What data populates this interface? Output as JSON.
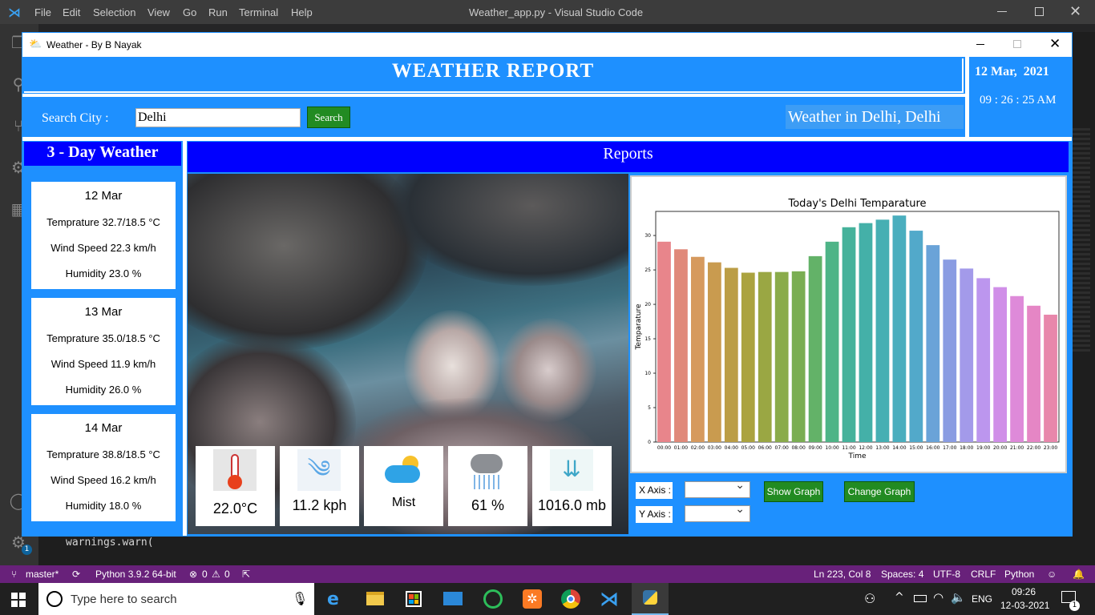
{
  "vscode": {
    "menu": [
      "File",
      "Edit",
      "Selection",
      "View",
      "Go",
      "Run",
      "Terminal",
      "Help"
    ],
    "window_title": "Weather_app.py - Visual Studio Code",
    "editor_line": "warnings.warn(",
    "status": {
      "branch": "master*",
      "python": "Python 3.9.2 64-bit",
      "errors": "0",
      "warnings": "0",
      "position": "Ln 223, Col 8",
      "spaces": "Spaces: 4",
      "encoding": "UTF-8",
      "eol": "CRLF",
      "language": "Python"
    },
    "accounts_badge": "1"
  },
  "taskbar": {
    "search_placeholder": "Type here to search",
    "lang": "ENG",
    "time": "09:26",
    "date": "12-03-2021",
    "notification_count": "1"
  },
  "app": {
    "window_title": "Weather - By B Nayak",
    "header_title": "WEATHER REPORT",
    "date": "12 Mar,  2021",
    "time": "09 : 26 : 25 AM",
    "search_label": "Search City :",
    "search_value": "Delhi",
    "search_button": "Search",
    "location_text": "Weather in Delhi, Delhi",
    "forecast_title": "3 - Day Weather",
    "reports_title": "Reports",
    "forecast": [
      {
        "day": "12 Mar",
        "temp": "Temprature 32.7/18.5 °C",
        "wind": "Wind Speed 22.3 km/h",
        "humidity": "Humidity 23.0 %"
      },
      {
        "day": "13 Mar",
        "temp": "Temprature 35.0/18.5 °C",
        "wind": "Wind Speed 11.9 km/h",
        "humidity": "Humidity 26.0 %"
      },
      {
        "day": "14 Mar",
        "temp": "Temprature 38.8/18.5 °C",
        "wind": "Wind Speed 16.2 km/h",
        "humidity": "Humidity 18.0 %"
      }
    ],
    "current": {
      "temperature": "22.0°C",
      "wind": "11.2 kph",
      "condition": "Mist",
      "humidity": "61 %",
      "pressure": "1016.0 mb"
    },
    "x_axis_label": "X Axis :",
    "y_axis_label": "Y Axis :",
    "show_graph": "Show Graph",
    "change_graph": "Change Graph"
  },
  "chart_data": {
    "type": "bar",
    "title": "Today's Delhi Temparature",
    "xlabel": "Time",
    "ylabel": "Temparature",
    "ylim": [
      0,
      33.5
    ],
    "yticks": [
      0,
      5,
      10,
      15,
      20,
      25,
      30
    ],
    "categories": [
      "00:00",
      "01:00",
      "02:00",
      "03:00",
      "04:00",
      "05:00",
      "06:00",
      "07:00",
      "08:00",
      "09:00",
      "10:00",
      "11:00",
      "12:00",
      "13:00",
      "14:00",
      "15:00",
      "16:00",
      "17:00",
      "18:00",
      "19:00",
      "20:00",
      "21:00",
      "22:00",
      "23:00"
    ],
    "values": [
      29.1,
      28.0,
      26.9,
      26.1,
      25.3,
      24.6,
      24.7,
      24.7,
      24.8,
      27.0,
      29.1,
      31.2,
      31.8,
      32.3,
      32.9,
      30.7,
      28.6,
      26.5,
      25.2,
      23.8,
      22.5,
      21.2,
      19.8,
      18.5
    ],
    "colors": [
      "#e8858b",
      "#e0897a",
      "#d69a5e",
      "#c99b4f",
      "#bb9d45",
      "#aba33f",
      "#9aa743",
      "#8aab4a",
      "#7aae52",
      "#63b268",
      "#4eb487",
      "#45b29b",
      "#44b0a8",
      "#46afb3",
      "#4aaebe",
      "#52a9ca",
      "#6aa3d8",
      "#8a9ce2",
      "#a39aea",
      "#bc96ee",
      "#d08fe8",
      "#de8ad9",
      "#e586c5",
      "#e887ab"
    ]
  }
}
